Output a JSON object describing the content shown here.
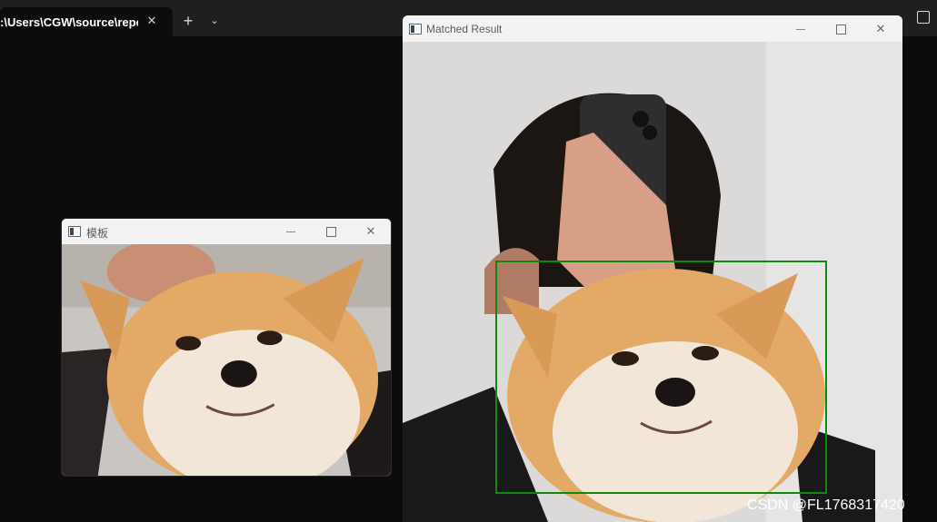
{
  "terminal": {
    "tab_title": ":\\Users\\CGW\\source\\repos\\",
    "close_glyph": "✕",
    "new_tab_glyph": "+",
    "dropdown_glyph": "⌄"
  },
  "template_window": {
    "title": "模板",
    "close_glyph": "✕"
  },
  "result_window": {
    "title": "Matched Result",
    "close_glyph": "✕",
    "match_box_color": "#0b8a0b"
  },
  "watermark": "CSDN @FL1768317420"
}
